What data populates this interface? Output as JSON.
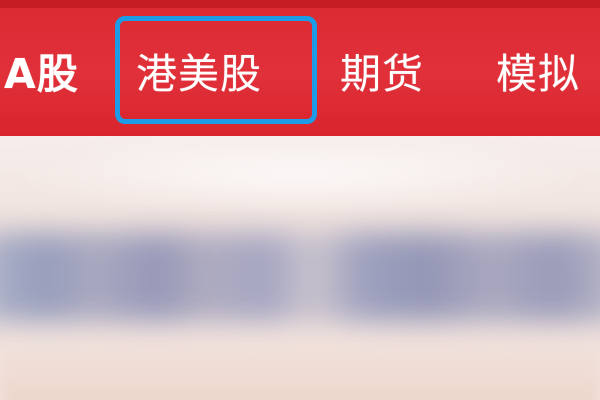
{
  "market_tabs": {
    "items": [
      {
        "label": "A股",
        "selected": false
      },
      {
        "label": "港美股",
        "selected": true
      },
      {
        "label": "期货",
        "selected": false
      },
      {
        "label": "模拟",
        "selected": false
      }
    ]
  },
  "colors": {
    "tabbar_bg": "#dc2a32",
    "tab_text": "#ffffff",
    "highlight_border": "#1e9be6"
  }
}
